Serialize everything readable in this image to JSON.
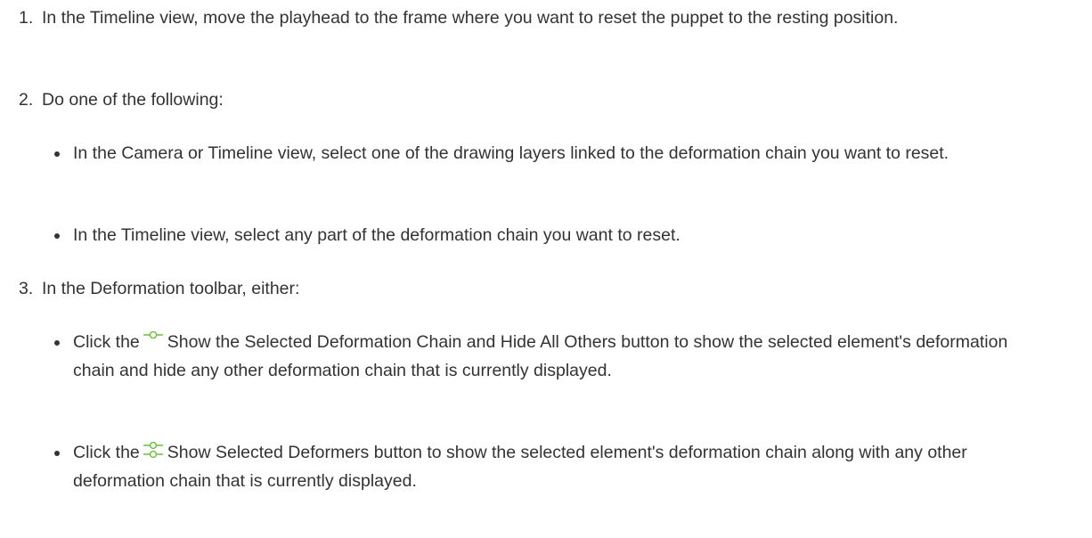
{
  "steps": [
    {
      "number": "1.",
      "text": "In the Timeline view, move the playhead to the frame where you want to reset the puppet to the resting position."
    },
    {
      "number": "2.",
      "text": "Do one of the following:",
      "bullets": [
        "In the Camera or Timeline view, select one of the drawing layers linked to the deformation chain you want to reset.",
        "In the Timeline view, select any part of the deformation chain you want to reset."
      ]
    },
    {
      "number": "3.",
      "text": "In the Deformation toolbar, either:",
      "bullets": [
        {
          "prefix": "Click the",
          "icon": "show-selected-deformation-chain-hide-others-icon",
          "suffix": "Show the Selected Deformation Chain and Hide All Others button to show the selected element's deformation chain and hide any other deformation chain that is currently displayed."
        },
        {
          "prefix": "Click the",
          "icon": "show-selected-deformers-icon",
          "suffix": "Show Selected Deformers button to show the selected element's deformation chain along with any other deformation chain that is currently displayed."
        }
      ]
    }
  ],
  "colors": {
    "text": "#333333",
    "icon": "#6abf3c"
  }
}
